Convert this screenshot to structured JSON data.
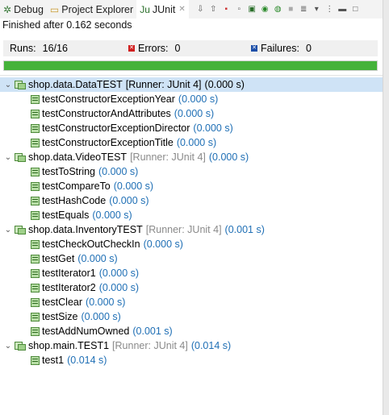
{
  "tabs": [
    {
      "label": "Debug",
      "icon": "debug-icon"
    },
    {
      "label": "Project Explorer",
      "icon": "project-explorer-icon"
    },
    {
      "label": "JUnit",
      "icon": "junit-icon",
      "active": true
    }
  ],
  "status": "Finished after 0.162 seconds",
  "counters": {
    "runs_label": "Runs:",
    "runs_value": "16/16",
    "errors_label": "Errors:",
    "errors_value": "0",
    "failures_label": "Failures:",
    "failures_value": "0"
  },
  "progress": {
    "fraction": 1.0,
    "color": "#45b23a"
  },
  "suites": [
    {
      "name": "shop.data.DataTEST",
      "meta": "[Runner: JUnit 4]",
      "time": "(0.000 s)",
      "selected": true,
      "cases": [
        {
          "name": "testConstructorExceptionYear",
          "time": "(0.000 s)"
        },
        {
          "name": "testConstructorAndAttributes",
          "time": "(0.000 s)"
        },
        {
          "name": "testConstructorExceptionDirector",
          "time": "(0.000 s)"
        },
        {
          "name": "testConstructorExceptionTitle",
          "time": "(0.000 s)"
        }
      ]
    },
    {
      "name": "shop.data.VideoTEST",
      "meta": "[Runner: JUnit 4]",
      "time": "(0.000 s)",
      "cases": [
        {
          "name": "testToString",
          "time": "(0.000 s)"
        },
        {
          "name": "testCompareTo",
          "time": "(0.000 s)"
        },
        {
          "name": "testHashCode",
          "time": "(0.000 s)"
        },
        {
          "name": "testEquals",
          "time": "(0.000 s)"
        }
      ]
    },
    {
      "name": "shop.data.InventoryTEST",
      "meta": "[Runner: JUnit 4]",
      "time": "(0.001 s)",
      "cases": [
        {
          "name": "testCheckOutCheckIn",
          "time": "(0.000 s)"
        },
        {
          "name": "testGet",
          "time": "(0.000 s)"
        },
        {
          "name": "testIterator1",
          "time": "(0.000 s)"
        },
        {
          "name": "testIterator2",
          "time": "(0.000 s)"
        },
        {
          "name": "testClear",
          "time": "(0.000 s)"
        },
        {
          "name": "testSize",
          "time": "(0.000 s)"
        },
        {
          "name": "testAddNumOwned",
          "time": "(0.001 s)"
        }
      ]
    },
    {
      "name": "shop.main.TEST1",
      "meta": "[Runner: JUnit 4]",
      "time": "(0.014 s)",
      "cases": [
        {
          "name": "test1",
          "time": "(0.014 s)"
        }
      ]
    }
  ]
}
